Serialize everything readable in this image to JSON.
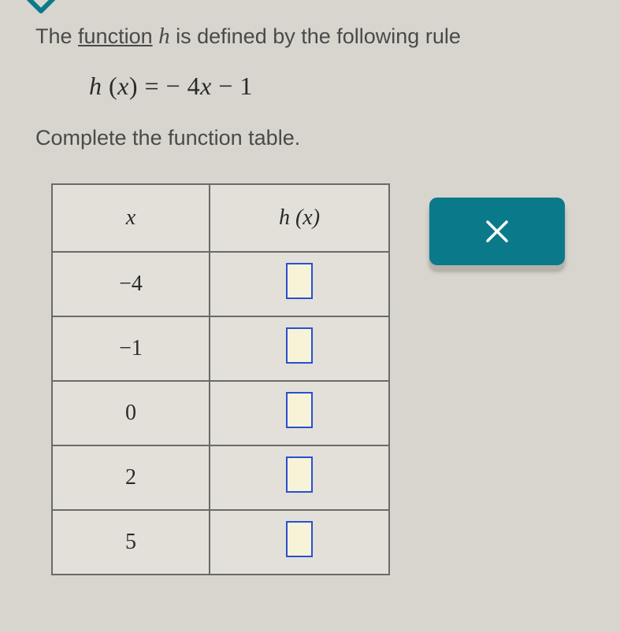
{
  "intro": {
    "prefix": "The ",
    "link_word": "function",
    "middle": " ",
    "func_name": "h",
    "suffix": " is defined by the following rule"
  },
  "equation": {
    "lhs_func": "h",
    "lhs_open": " (",
    "lhs_var": "x",
    "lhs_close": ") ",
    "eq": "= ",
    "neg": "− ",
    "coef": "4",
    "var2": "x",
    "minus": " − ",
    "const": "1"
  },
  "instruction": "Complete the function table.",
  "table": {
    "header_x": "x",
    "header_hx_func": "h",
    "header_hx_open": " (",
    "header_hx_var": "x",
    "header_hx_close": ")",
    "rows": [
      {
        "x": "−4"
      },
      {
        "x": "−1"
      },
      {
        "x": "0"
      },
      {
        "x": "2"
      },
      {
        "x": "5"
      }
    ]
  },
  "buttons": {
    "close_label": "×"
  }
}
